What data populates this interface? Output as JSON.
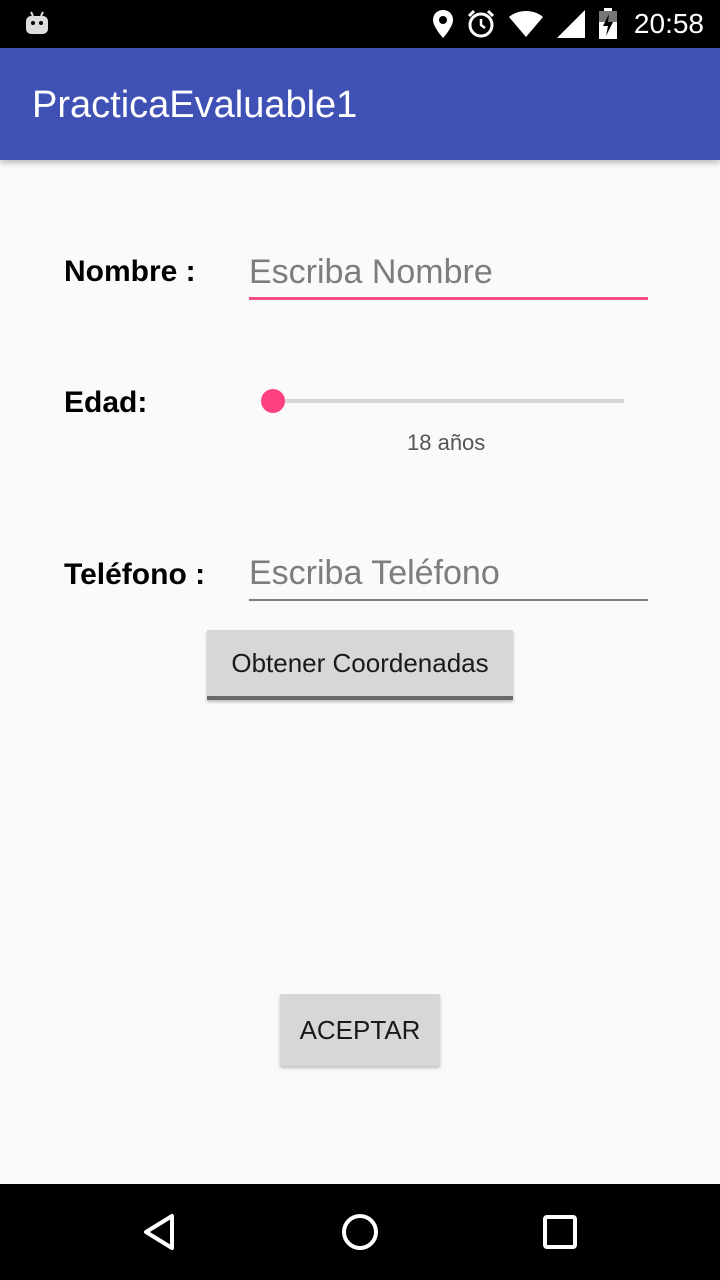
{
  "status_bar": {
    "time": "20:58",
    "icons": [
      "android-debug-icon",
      "location-icon",
      "alarm-icon",
      "wifi-icon",
      "signal-icon",
      "battery-charging-icon"
    ]
  },
  "app_bar": {
    "title": "PracticaEvaluable1"
  },
  "form": {
    "name_label": "Nombre :",
    "name_placeholder": "Escriba Nombre",
    "name_value": "",
    "age_label": "Edad:",
    "age_slider_value": 0,
    "age_text": "18 años",
    "phone_label": "Teléfono :",
    "phone_placeholder": "Escriba Teléfono",
    "phone_value": ""
  },
  "buttons": {
    "coords_label": "Obtener Coordenadas",
    "accept_label": "ACEPTAR"
  },
  "nav_bar": {
    "icons": [
      "back-icon",
      "home-icon",
      "recents-icon"
    ]
  },
  "colors": {
    "primary": "#3f51b5",
    "accent": "#ff4081",
    "background": "#fafafa"
  }
}
